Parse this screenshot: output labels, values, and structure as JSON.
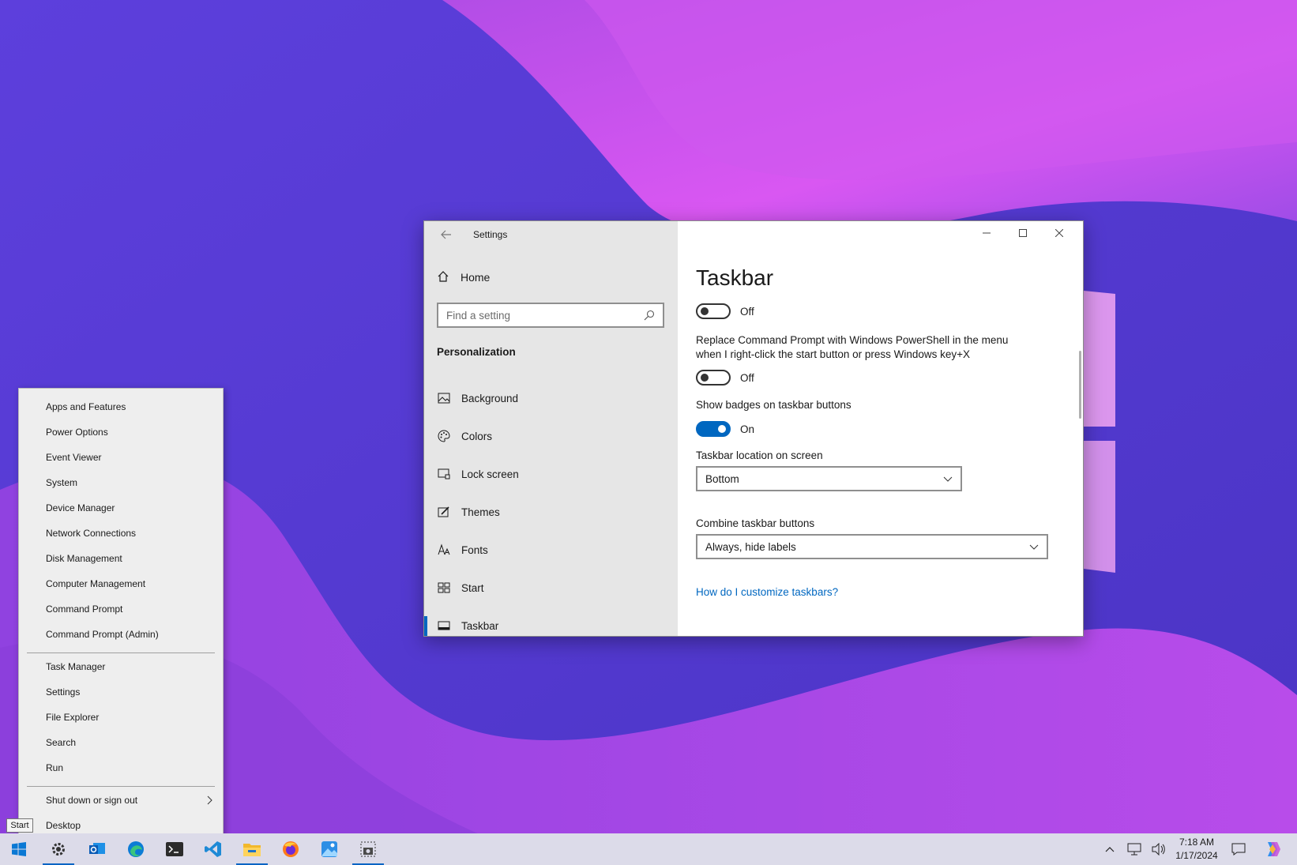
{
  "colors": {
    "accent": "#0067c0",
    "sidebar_bg": "#e6e6e6",
    "menu_bg": "#eeeeee",
    "taskbar_bg": "#dcdbe9",
    "wallpaper_base": "#5b3fd9",
    "wallpaper_pink": "#c74de8"
  },
  "settings": {
    "window_title": "Settings",
    "back_icon": "back-arrow-icon",
    "home_label": "Home",
    "search_placeholder": "Find a setting",
    "section_label": "Personalization",
    "nav_items": [
      {
        "label": "Background",
        "icon": "picture-icon"
      },
      {
        "label": "Colors",
        "icon": "palette-icon"
      },
      {
        "label": "Lock screen",
        "icon": "lock-screen-icon"
      },
      {
        "label": "Themes",
        "icon": "themes-brush-icon"
      },
      {
        "label": "Fonts",
        "icon": "fonts-icon"
      },
      {
        "label": "Start",
        "icon": "start-tiles-icon"
      },
      {
        "label": "Taskbar",
        "icon": "taskbar-icon",
        "active": true
      }
    ],
    "page_title": "Taskbar",
    "toggle1_state": "Off",
    "powershell_label_line1": "Replace Command Prompt with Windows PowerShell in the menu",
    "powershell_label_line2": "when I right-click the start button or press Windows key+X",
    "toggle2_state": "Off",
    "badges_label": "Show badges on taskbar buttons",
    "toggle3_state": "On",
    "location_label": "Taskbar location on screen",
    "location_value": "Bottom",
    "combine_label": "Combine taskbar buttons",
    "combine_value": "Always, hide labels",
    "help_link": "How do I customize taskbars?"
  },
  "menu": {
    "group1": [
      "Apps and Features",
      "Power Options",
      "Event Viewer",
      "System",
      "Device Manager",
      "Network Connections",
      "Disk Management",
      "Computer Management",
      "Command Prompt",
      "Command Prompt (Admin)"
    ],
    "group2": [
      "Task Manager",
      "Settings",
      "File Explorer",
      "Search",
      "Run"
    ],
    "group3": [
      "Shut down or sign out",
      "Desktop"
    ]
  },
  "tooltip": "Start",
  "taskbar": {
    "icons": [
      "windows-start-icon",
      "settings-gear-icon",
      "outlook-icon",
      "edge-icon",
      "terminal-icon",
      "vscode-icon",
      "file-explorer-icon",
      "firefox-icon",
      "photos-icon",
      "snipping-tool-icon"
    ],
    "tray": [
      "chevron-up-icon",
      "network-icon",
      "volume-icon",
      "notification-icon",
      "copilot-icon"
    ],
    "time": "7:18 AM",
    "date": "1/17/2024"
  }
}
